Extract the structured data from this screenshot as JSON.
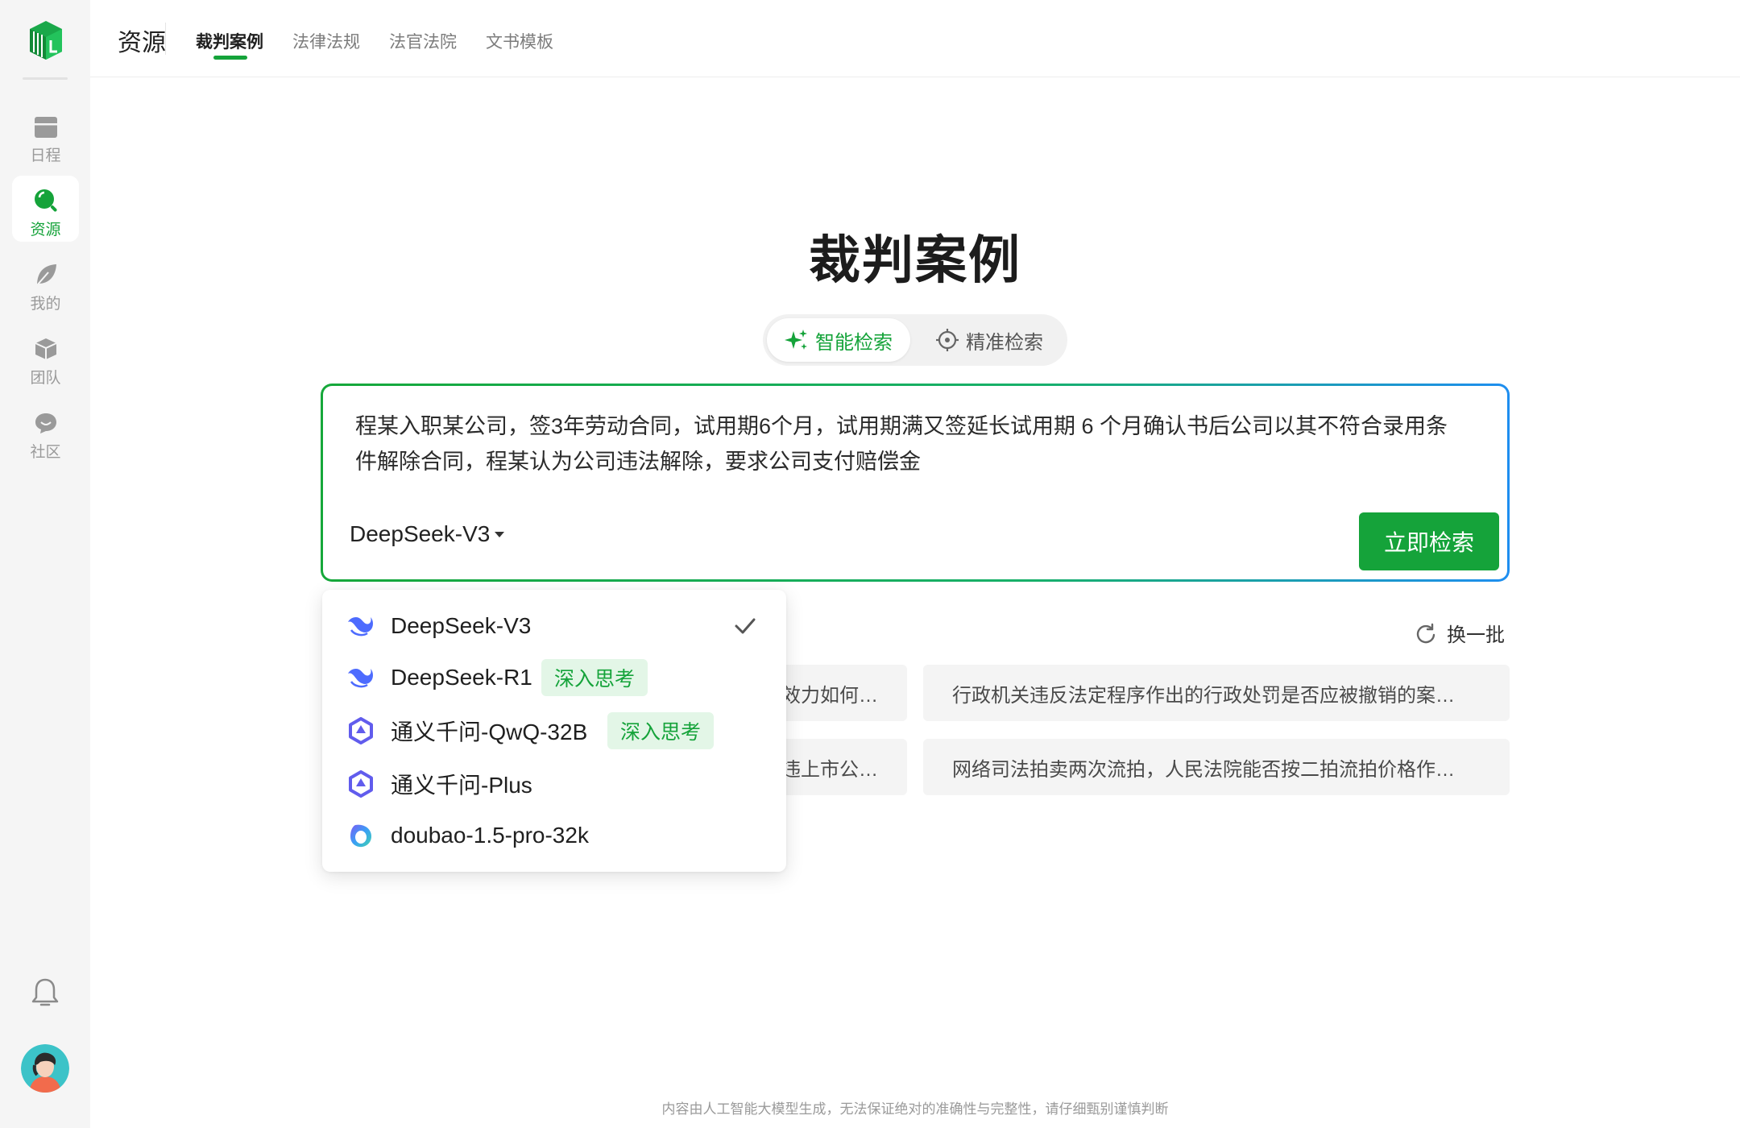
{
  "sidebar": {
    "items": [
      {
        "label": "日程",
        "icon": "calendar-icon"
      },
      {
        "label": "资源",
        "icon": "search-icon",
        "active": true
      },
      {
        "label": "我的",
        "icon": "leaf-icon"
      },
      {
        "label": "团队",
        "icon": "cube-icon"
      },
      {
        "label": "社区",
        "icon": "chat-icon"
      }
    ]
  },
  "header": {
    "title": "资源",
    "tabs": [
      {
        "label": "裁判案例",
        "active": true
      },
      {
        "label": "法律法规"
      },
      {
        "label": "法官法院"
      },
      {
        "label": "文书模板"
      }
    ]
  },
  "main": {
    "title": "裁判案例",
    "modes": {
      "smart": "智能检索",
      "precise": "精准检索"
    },
    "query": "程某入职某公司，签3年劳动合同，试用期6个月，试用期满又签延长试用期 6 个月确认书后公司以其不符合录用条件解除合同，程某认为公司违法解除，要求公司支付赔偿金",
    "selected_model": "DeepSeek-V3",
    "search_button": "立即检索",
    "refresh_label": "换一批",
    "suggestions": [
      "效力如何…",
      "行政机关违反法定程序作出的行政处罚是否应被撤销的案…",
      "违上市公…",
      "网络司法拍卖两次流拍，人民法院能否按二拍流拍价格作…"
    ],
    "disclaimer": "内容由人工智能大模型生成，无法保证绝对的准确性与完整性，请仔细甄别谨慎判断"
  },
  "dropdown": {
    "options": [
      {
        "label": "DeepSeek-V3",
        "icon": "deepseek-icon",
        "selected": true
      },
      {
        "label": "DeepSeek-R1",
        "icon": "deepseek-icon",
        "badge": "深入思考"
      },
      {
        "label": "通义千问-QwQ-32B",
        "icon": "qwen-icon",
        "badge": "深入思考"
      },
      {
        "label": "通义千问-Plus",
        "icon": "qwen-icon"
      },
      {
        "label": "doubao-1.5-pro-32k",
        "icon": "doubao-icon"
      }
    ]
  },
  "colors": {
    "accent": "#15a33a",
    "badge_bg": "#e3f6e7",
    "sidebar_bg": "#f5f5f5",
    "deepseek": "#4d6bfe",
    "qwen": "#615ced"
  }
}
